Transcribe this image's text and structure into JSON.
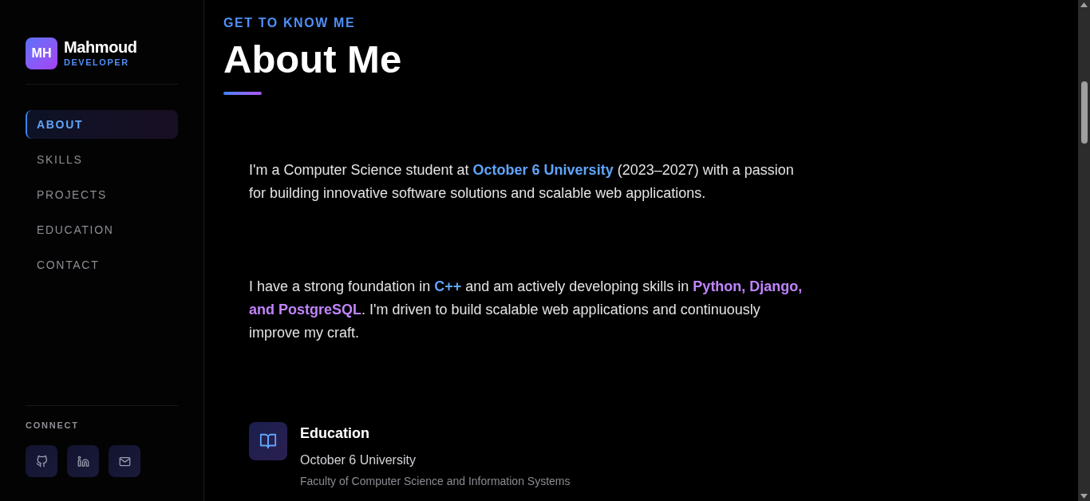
{
  "sidebar": {
    "logo": {
      "initials": "MH",
      "name": "Mahmoud",
      "role": "DEVELOPER"
    },
    "nav": [
      {
        "label": "ABOUT",
        "selected": true
      },
      {
        "label": "SKILLS",
        "selected": false
      },
      {
        "label": "PROJECTS",
        "selected": false
      },
      {
        "label": "EDUCATION",
        "selected": false
      },
      {
        "label": "CONTACT",
        "selected": false
      }
    ],
    "connect": {
      "heading": "CONNECT",
      "links": [
        {
          "kind": "github"
        },
        {
          "kind": "linkedin"
        },
        {
          "kind": "email"
        }
      ]
    }
  },
  "section": {
    "eyebrow": "GET TO KNOW ME",
    "title": "About Me",
    "paragraphs": [
      [
        {
          "text": "I'm a Computer Science student at ",
          "kind": "plain"
        },
        {
          "text": "October 6 University",
          "kind": "accent"
        },
        {
          "text": " (2023–2027) with a passion for building innovative software solutions and scalable web applications.",
          "kind": "plain"
        }
      ],
      [
        {
          "text": "I have a strong foundation in ",
          "kind": "plain"
        },
        {
          "text": "C++",
          "kind": "accent"
        },
        {
          "text": " and am actively developing skills in ",
          "kind": "plain"
        },
        {
          "text": "Python, Django, and PostgreSQL",
          "kind": "highlight"
        },
        {
          "text": ". I'm driven to build scalable web applications and continuously improve my craft.",
          "kind": "plain"
        }
      ]
    ],
    "education": {
      "heading": "Education",
      "school": "October 6 University",
      "faculty": "Faculty of Computer Science and Information Systems"
    }
  }
}
